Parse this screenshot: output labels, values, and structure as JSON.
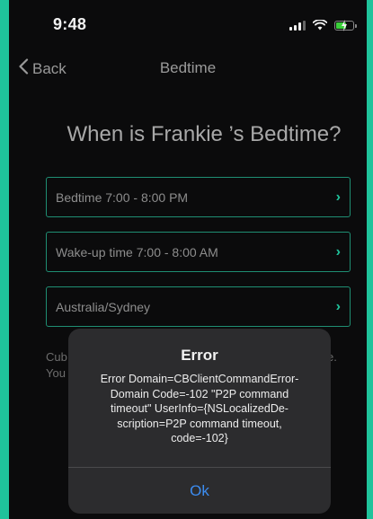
{
  "status_bar": {
    "time": "9:48"
  },
  "nav": {
    "back_label": "Back",
    "title": "Bedtime"
  },
  "page": {
    "heading": "When is Frankie ’s Bedtime?"
  },
  "fields": {
    "bedtime": "Bedtime 7:00 - 8:00 PM",
    "wakeup": "Wake-up time 7:00 - 8:00 AM",
    "timezone": "Australia/Sydney",
    "chevron": "›"
  },
  "background_text": {
    "left_line1": "Cub",
    "left_line2": "You",
    "right_line1": "e."
  },
  "alert": {
    "title": "Error",
    "message_lines": [
      "Error Domain=CBClientCommandError-",
      "Domain Code=-102 \"P2P command",
      "timeout\" UserInfo={NSLocalizedDe-",
      "scription=P2P command timeout,",
      "code=-102}"
    ],
    "ok_label": "Ok"
  },
  "colors": {
    "accent": "#1fc39b",
    "link": "#3c8cf0",
    "background": "#0b0b0c",
    "alert_background": "#2c2c2e"
  },
  "icons": [
    "signal-icon",
    "wifi-icon",
    "battery-icon",
    "chevron-left-icon",
    "chevron-right-icon"
  ]
}
